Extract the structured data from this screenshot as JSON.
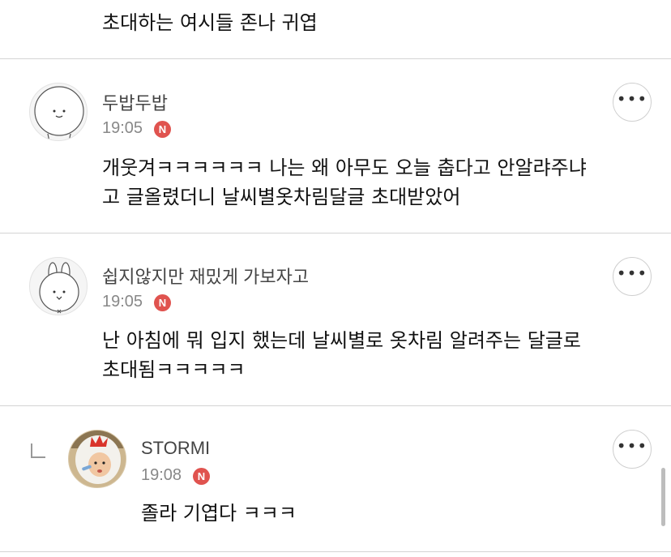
{
  "top_comment": {
    "text": "초대하는 여시들 존나 귀엽"
  },
  "comments": [
    {
      "author": "두밥두밥",
      "time": "19:05",
      "badge": "N",
      "avatar_icon": "bear-character-icon",
      "lines": [
        "개웃겨ㅋㅋㅋㅋㅋㅋ 나는 왜 아무도 오늘 춥다고 안알랴주냐",
        "고 글올렸더니 날씨별옷차림달글 초대받았어"
      ],
      "more_label": "•••"
    },
    {
      "author": "쉽지않지만 재밌게 가보자고",
      "time": "19:05",
      "badge": "N",
      "avatar_icon": "rabbit-character-icon",
      "lines": [
        "난 아침에 뭐 입지 했는데 날씨별로 옷차림 알려주는 달글로",
        "초대됨ㅋㅋㅋㅋㅋ"
      ],
      "more_label": "•••"
    },
    {
      "author": "STORMI",
      "time": "19:08",
      "badge": "N",
      "avatar_icon": "child-photo-avatar",
      "is_reply": true,
      "lines": [
        "졸라 기엽다 ㅋㅋㅋ"
      ],
      "more_label": "•••"
    }
  ],
  "colors": {
    "badge": "#e0534f",
    "divider": "#d4d4d4",
    "meta_text": "#888888"
  }
}
